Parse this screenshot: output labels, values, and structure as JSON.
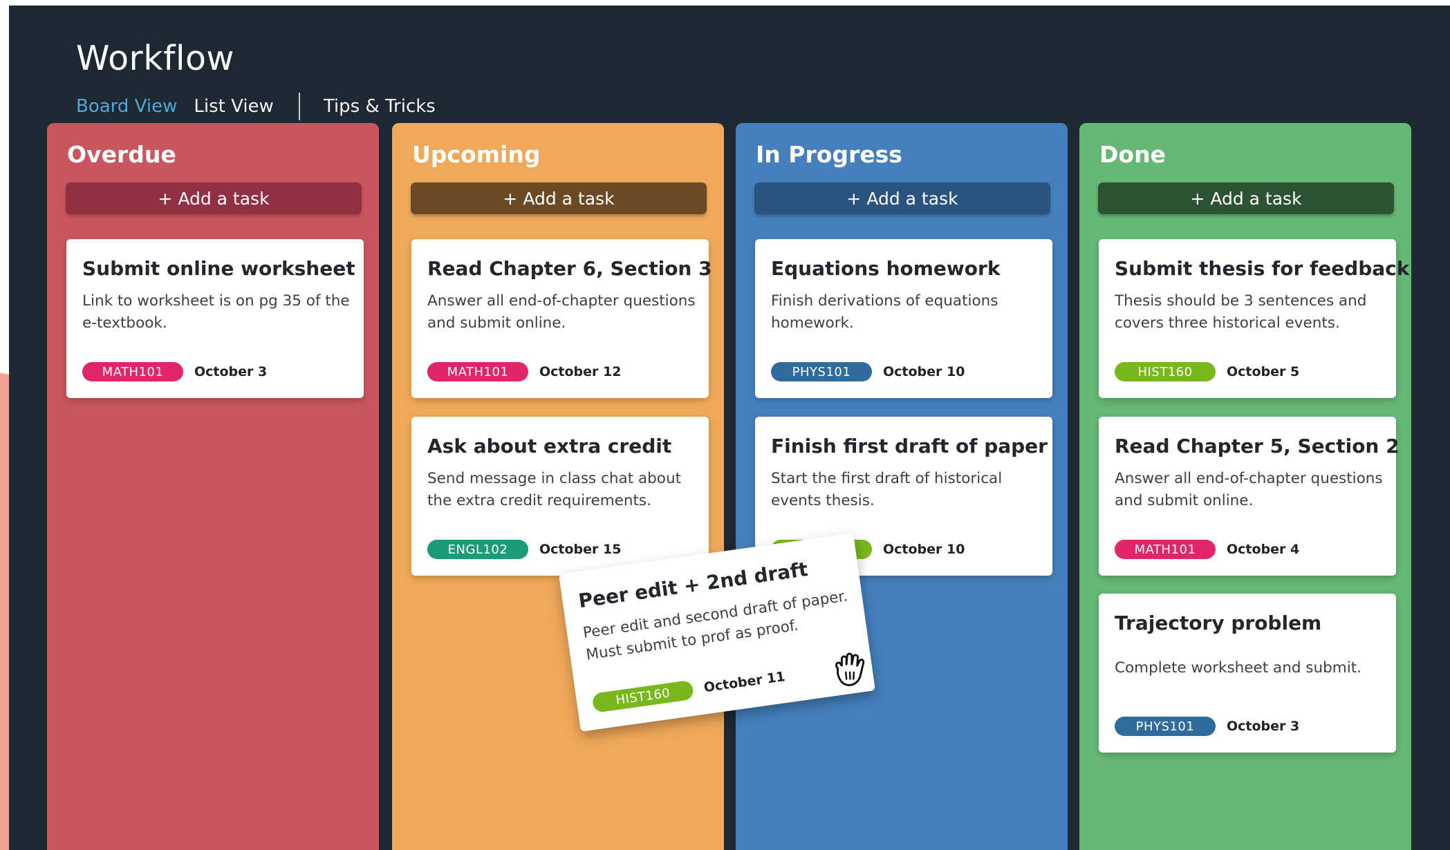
{
  "app": {
    "title": "Workflow"
  },
  "nav": [
    {
      "label": "Board View",
      "active": true
    },
    {
      "label": "List View",
      "active": false
    },
    {
      "label": "Tips & Tricks",
      "active": false
    }
  ],
  "add_task_label": "+ Add a task",
  "columns": [
    {
      "title": "Overdue",
      "cards": [
        {
          "title": "Submit online worksheet",
          "description": "Link to worksheet is on pg 35 of the e-textbook.",
          "tag": "MATH101",
          "date": "October 3"
        }
      ]
    },
    {
      "title": "Upcoming",
      "cards": [
        {
          "title": "Read Chapter 6, Section 3",
          "description": "Answer all end-of-chapter questions and submit online.",
          "tag": "MATH101",
          "date": "October 12"
        },
        {
          "title": "Ask about extra credit",
          "description": "Send message in class chat about the extra credit requirements.",
          "tag": "ENGL102",
          "date": "October 15"
        }
      ]
    },
    {
      "title": "In Progress",
      "cards": [
        {
          "title": "Equations homework",
          "description": "Finish derivations of equations homework.",
          "tag": "PHYS101",
          "date": "October 10"
        },
        {
          "title": "Finish first draft of paper",
          "description": "Start the first draft of historical events thesis.",
          "tag": "",
          "date": "October 10"
        }
      ]
    },
    {
      "title": "Done",
      "cards": [
        {
          "title": "Submit thesis for feedback",
          "description": "Thesis should be 3 sentences and covers three historical events.",
          "tag": "HIST160",
          "date": "October 5"
        },
        {
          "title": "Read Chapter 5, Section 2",
          "description": "Answer all end-of-chapter questions and submit online.",
          "tag": "MATH101",
          "date": "October 4"
        },
        {
          "title": "Trajectory problem",
          "description": "Complete worksheet and submit.",
          "tag": "PHYS101",
          "date": "October 3"
        }
      ]
    }
  ],
  "dragging_card": {
    "title": "Peer edit + 2nd draft",
    "description": "Peer edit and second draft of paper. Must submit to prof as proof.",
    "tag": "HIST160",
    "date": "October 11"
  },
  "icons": {
    "drag_cursor": "grab-hand-icon"
  },
  "colors": {
    "background": "#1d2833",
    "overdue": "#c9565e",
    "upcoming": "#f0a95a",
    "in_progress": "#4580bd",
    "done": "#66b875",
    "tag_math": "#e12569",
    "tag_phys": "#2f6b9d",
    "tag_engl": "#1c9b78",
    "tag_hist": "#79b81c",
    "nav_active": "#4fa9d8"
  }
}
